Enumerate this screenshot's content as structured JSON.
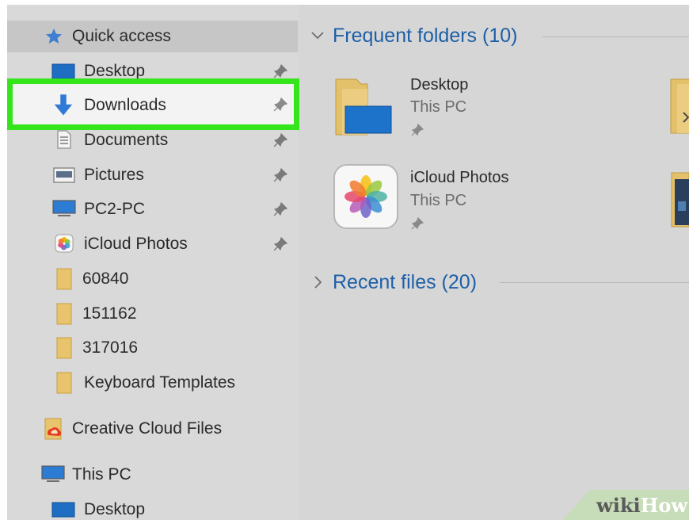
{
  "sidebar": {
    "quick_access": "Quick access",
    "pinned": [
      {
        "label": "Desktop",
        "icon": "desktop-icon"
      },
      {
        "label": "Downloads",
        "icon": "downloads-icon"
      },
      {
        "label": "Documents",
        "icon": "documents-icon"
      },
      {
        "label": "Pictures",
        "icon": "pictures-icon"
      },
      {
        "label": "PC2-PC",
        "icon": "computer-icon"
      },
      {
        "label": "iCloud Photos",
        "icon": "icloud-photos-icon"
      }
    ],
    "folders": [
      {
        "label": "60840"
      },
      {
        "label": "151162"
      },
      {
        "label": "317016"
      },
      {
        "label": "Keyboard Templates"
      }
    ],
    "creative_cloud": "Creative Cloud Files",
    "this_pc": "This PC",
    "this_pc_desktop": "Desktop"
  },
  "main": {
    "frequent_header": "Frequent folders (10)",
    "recent_header": "Recent files (20)",
    "tiles": [
      {
        "name": "Desktop",
        "location": "This PC"
      },
      {
        "name": "iCloud Photos",
        "location": "This PC"
      }
    ]
  },
  "watermark": {
    "part1": "wiki",
    "part2": "How"
  },
  "colors": {
    "selection_outline": "#33e51a",
    "header_blue": "#1d5fa8",
    "panel_bg": "#d6d6d6"
  }
}
